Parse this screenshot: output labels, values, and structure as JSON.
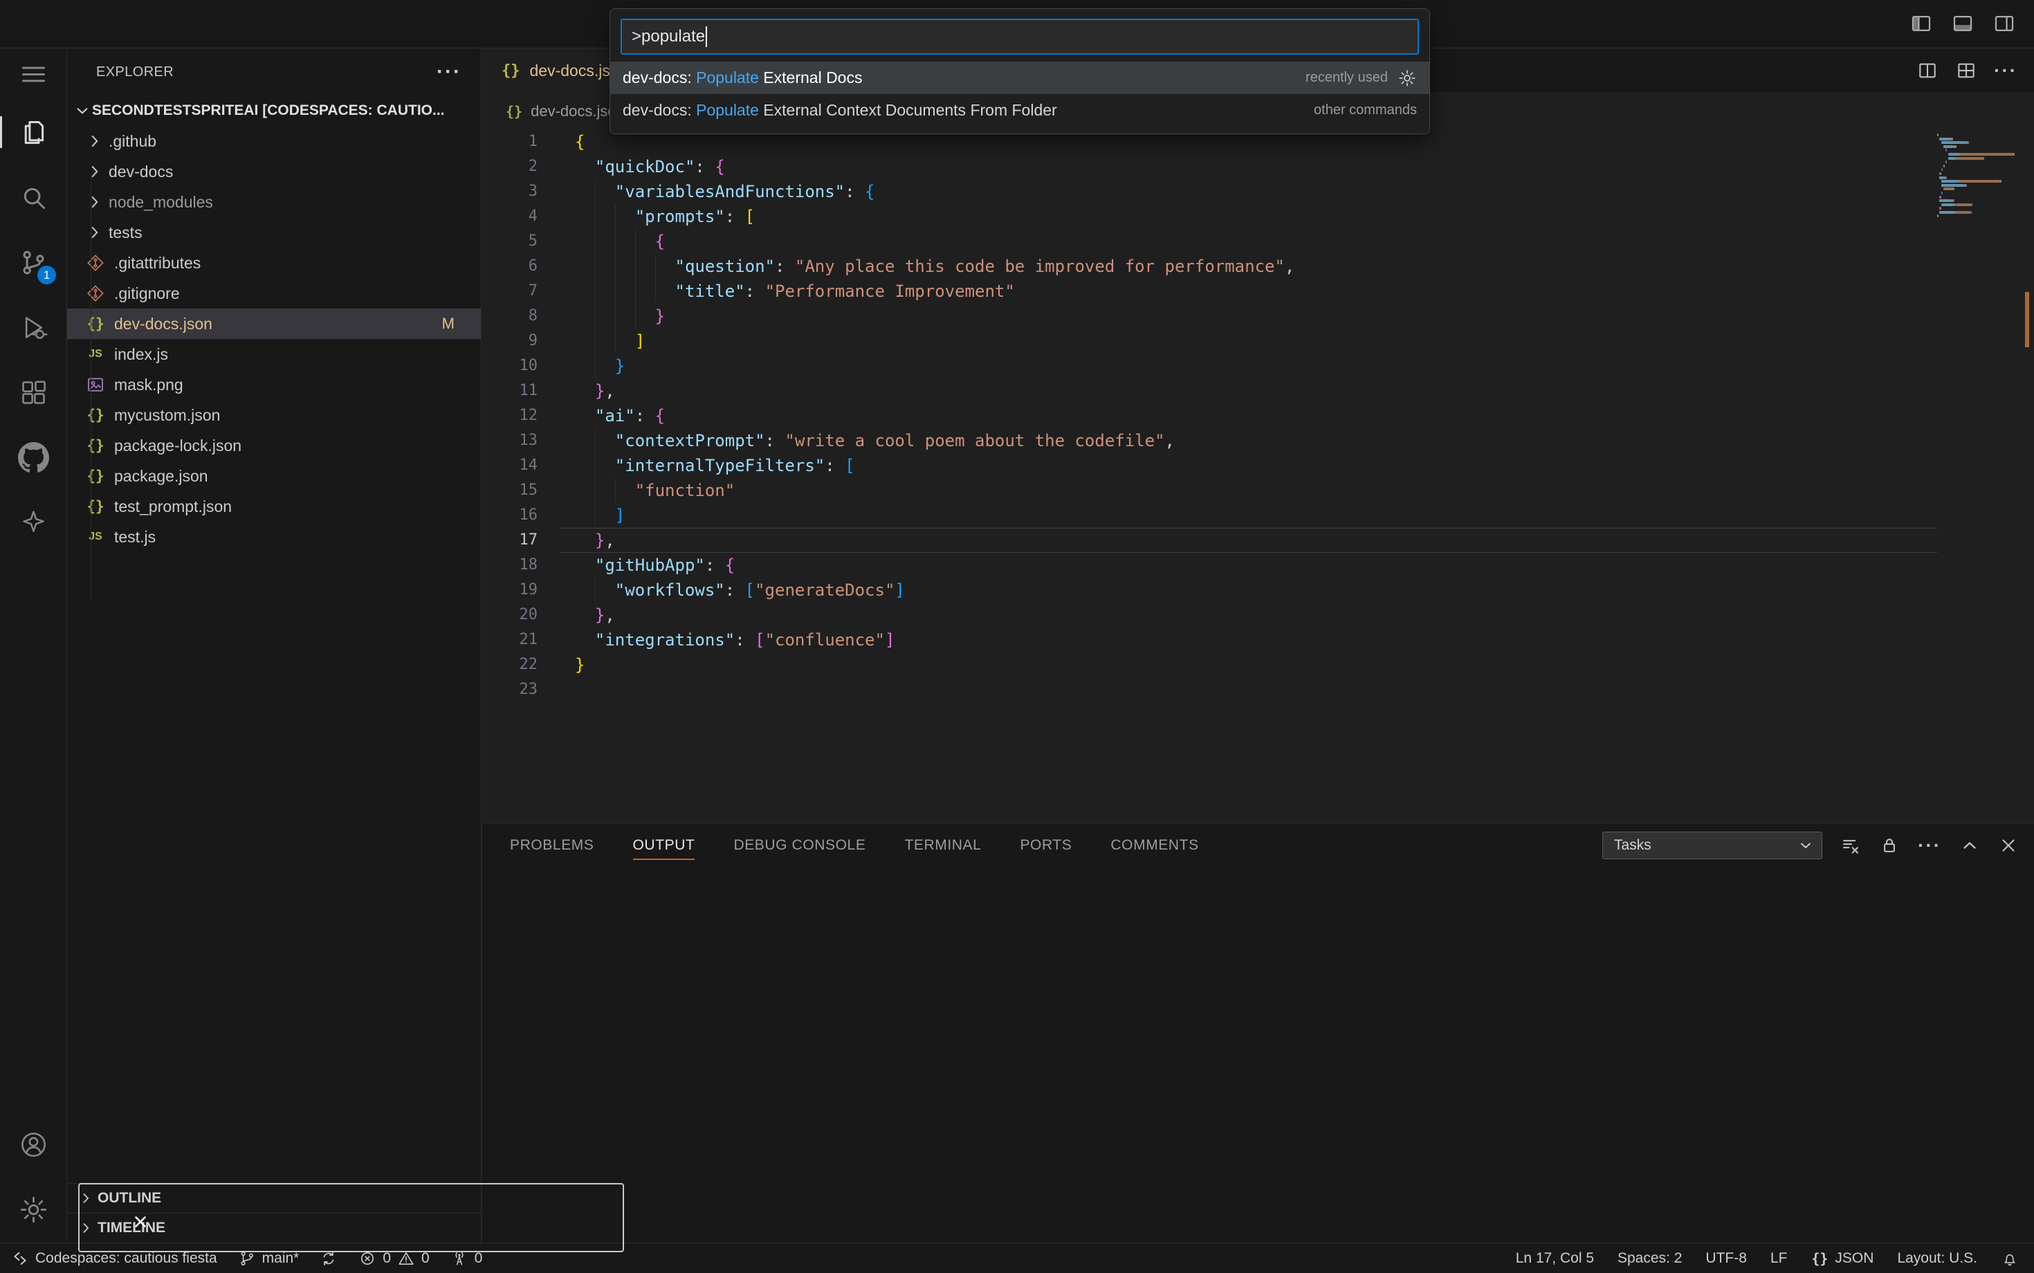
{
  "colors": {
    "accent": "#0078d4",
    "match_highlight": "#44a8f5",
    "modified": "#e2c08d",
    "panel_active_underline": "#c4622d",
    "badge": "#0078d4",
    "selection_row": "#3b3e41"
  },
  "title_bar": {
    "layout_controls": [
      "toggle-primary-sidebar",
      "toggle-panel",
      "toggle-secondary-sidebar"
    ]
  },
  "palette": {
    "input_value": ">populate",
    "items": [
      {
        "pre": "dev-docs: ",
        "hl": "Populate",
        "post": " External Docs",
        "meta": "recently used",
        "gear": true,
        "selected": true
      },
      {
        "pre": "dev-docs: ",
        "hl": "Populate",
        "post": " External Context Documents From Folder",
        "meta": "other commands",
        "gear": false,
        "selected": false
      }
    ]
  },
  "activity_bar": {
    "items": [
      {
        "name": "menu",
        "icon": "menu"
      },
      {
        "name": "explorer",
        "icon": "files",
        "active": true
      },
      {
        "name": "search",
        "icon": "search"
      },
      {
        "name": "source-control",
        "icon": "source-control",
        "badge": "1"
      },
      {
        "name": "run-and-debug",
        "icon": "debug"
      },
      {
        "name": "extensions",
        "icon": "extensions"
      },
      {
        "name": "github",
        "icon": "github"
      },
      {
        "name": "extension-logo",
        "icon": "logo"
      }
    ],
    "bottom": [
      {
        "name": "accounts",
        "icon": "account"
      },
      {
        "name": "settings",
        "icon": "gear"
      }
    ]
  },
  "sidebar": {
    "header": "EXPLORER",
    "header_more": "···",
    "root_label": "SECONDTESTSPRITEAI [CODESPACES: CAUTIO...",
    "files": [
      {
        "label": ".github",
        "type": "folder"
      },
      {
        "label": "dev-docs",
        "type": "folder"
      },
      {
        "label": "node_modules",
        "type": "folder",
        "dim": true
      },
      {
        "label": "tests",
        "type": "folder"
      },
      {
        "label": ".gitattributes",
        "type": "git"
      },
      {
        "label": ".gitignore",
        "type": "git"
      },
      {
        "label": "dev-docs.json",
        "type": "json",
        "selected": true,
        "modified": true,
        "badge": "M"
      },
      {
        "label": "index.js",
        "type": "js"
      },
      {
        "label": "mask.png",
        "type": "image"
      },
      {
        "label": "mycustom.json",
        "type": "json"
      },
      {
        "label": "package-lock.json",
        "type": "json"
      },
      {
        "label": "package.json",
        "type": "json"
      },
      {
        "label": "test_prompt.json",
        "type": "json"
      },
      {
        "label": "test.js",
        "type": "js"
      }
    ],
    "sections": [
      {
        "label": "OUTLINE"
      },
      {
        "label": "TIMELINE"
      }
    ]
  },
  "editor": {
    "tab_label": "dev-docs.json",
    "breadcrumb_label": "dev-docs.json",
    "active_line": 17,
    "lines": [
      {
        "toks": [
          [
            "{",
            "b1"
          ]
        ]
      },
      {
        "toks": [
          [
            "  ",
            "p"
          ],
          [
            "\"quickDoc\"",
            "k"
          ],
          [
            ": ",
            "p"
          ],
          [
            "{",
            "b2"
          ]
        ]
      },
      {
        "toks": [
          [
            "    ",
            "p"
          ],
          [
            "\"variablesAndFunctions\"",
            "k"
          ],
          [
            ": ",
            "p"
          ],
          [
            "{",
            "b3"
          ]
        ]
      },
      {
        "toks": [
          [
            "      ",
            "p"
          ],
          [
            "\"prompts\"",
            "k"
          ],
          [
            ": ",
            "p"
          ],
          [
            "[",
            "b1"
          ]
        ]
      },
      {
        "toks": [
          [
            "        ",
            "p"
          ],
          [
            "{",
            "b2"
          ]
        ]
      },
      {
        "toks": [
          [
            "          ",
            "p"
          ],
          [
            "\"question\"",
            "k"
          ],
          [
            ": ",
            "p"
          ],
          [
            "\"Any place this code be improved for performance\"",
            "s"
          ],
          [
            ",",
            "p"
          ]
        ]
      },
      {
        "toks": [
          [
            "          ",
            "p"
          ],
          [
            "\"title\"",
            "k"
          ],
          [
            ": ",
            "p"
          ],
          [
            "\"Performance Improvement\"",
            "s"
          ]
        ]
      },
      {
        "toks": [
          [
            "        ",
            "p"
          ],
          [
            "}",
            "b2"
          ]
        ]
      },
      {
        "toks": [
          [
            "      ",
            "p"
          ],
          [
            "]",
            "b1"
          ]
        ]
      },
      {
        "toks": [
          [
            "    ",
            "p"
          ],
          [
            "}",
            "b3"
          ]
        ]
      },
      {
        "toks": [
          [
            "  ",
            "p"
          ],
          [
            "}",
            "b2"
          ],
          [
            ",",
            "p"
          ]
        ]
      },
      {
        "toks": [
          [
            "  ",
            "p"
          ],
          [
            "\"ai\"",
            "k"
          ],
          [
            ": ",
            "p"
          ],
          [
            "{",
            "b2"
          ]
        ]
      },
      {
        "toks": [
          [
            "    ",
            "p"
          ],
          [
            "\"contextPrompt\"",
            "k"
          ],
          [
            ": ",
            "p"
          ],
          [
            "\"write a cool poem about the codefile\"",
            "s"
          ],
          [
            ",",
            "p"
          ]
        ]
      },
      {
        "toks": [
          [
            "    ",
            "p"
          ],
          [
            "\"internalTypeFilters\"",
            "k"
          ],
          [
            ": ",
            "p"
          ],
          [
            "[",
            "b3"
          ]
        ]
      },
      {
        "toks": [
          [
            "      ",
            "p"
          ],
          [
            "\"function\"",
            "s"
          ]
        ]
      },
      {
        "toks": [
          [
            "    ",
            "p"
          ],
          [
            "]",
            "b3"
          ]
        ]
      },
      {
        "toks": [
          [
            "  ",
            "p"
          ],
          [
            "}",
            "b2"
          ],
          [
            ",",
            "p"
          ]
        ]
      },
      {
        "toks": [
          [
            "  ",
            "p"
          ],
          [
            "\"gitHubApp\"",
            "k"
          ],
          [
            ": ",
            "p"
          ],
          [
            "{",
            "b2"
          ]
        ]
      },
      {
        "toks": [
          [
            "    ",
            "p"
          ],
          [
            "\"workflows\"",
            "k"
          ],
          [
            ": ",
            "p"
          ],
          [
            "[",
            "b3"
          ],
          [
            "\"generateDocs\"",
            "s"
          ],
          [
            "]",
            "b3"
          ]
        ]
      },
      {
        "toks": [
          [
            "  ",
            "p"
          ],
          [
            "}",
            "b2"
          ],
          [
            ",",
            "p"
          ]
        ]
      },
      {
        "toks": [
          [
            "  ",
            "p"
          ],
          [
            "\"integrations\"",
            "k"
          ],
          [
            ": ",
            "p"
          ],
          [
            "[",
            "b2"
          ],
          [
            "\"confluence\"",
            "s"
          ],
          [
            "]",
            "b2"
          ]
        ]
      },
      {
        "toks": [
          [
            "}",
            "b1"
          ]
        ]
      },
      {
        "toks": []
      }
    ]
  },
  "panel": {
    "tabs": [
      "PROBLEMS",
      "OUTPUT",
      "DEBUG CONSOLE",
      "TERMINAL",
      "PORTS",
      "COMMENTS"
    ],
    "active_tab": "OUTPUT",
    "dropdown_value": "Tasks"
  },
  "status_bar": {
    "left": [
      {
        "name": "remote-indicator",
        "icon": "remote",
        "label": "Codespaces: cautious fiesta"
      },
      {
        "name": "branch-status",
        "icon": "branch",
        "label": "main*"
      },
      {
        "name": "sync-button",
        "icon": "sync",
        "label": ""
      },
      {
        "name": "problems-status",
        "icon": "error",
        "label": "0",
        "icon2": "warning",
        "label2": "0"
      },
      {
        "name": "ports-status",
        "icon": "radio-tower",
        "label": "0"
      }
    ],
    "right": [
      {
        "name": "cursor-position",
        "label": "Ln 17, Col 5"
      },
      {
        "name": "indentation",
        "label": "Spaces: 2"
      },
      {
        "name": "encoding",
        "label": "UTF-8"
      },
      {
        "name": "eol",
        "label": "LF"
      },
      {
        "name": "language-mode",
        "icon": "braces",
        "label": "JSON"
      },
      {
        "name": "keyboard-layout",
        "label": "Layout: U.S."
      },
      {
        "name": "notifications",
        "icon": "bell",
        "label": ""
      }
    ]
  }
}
